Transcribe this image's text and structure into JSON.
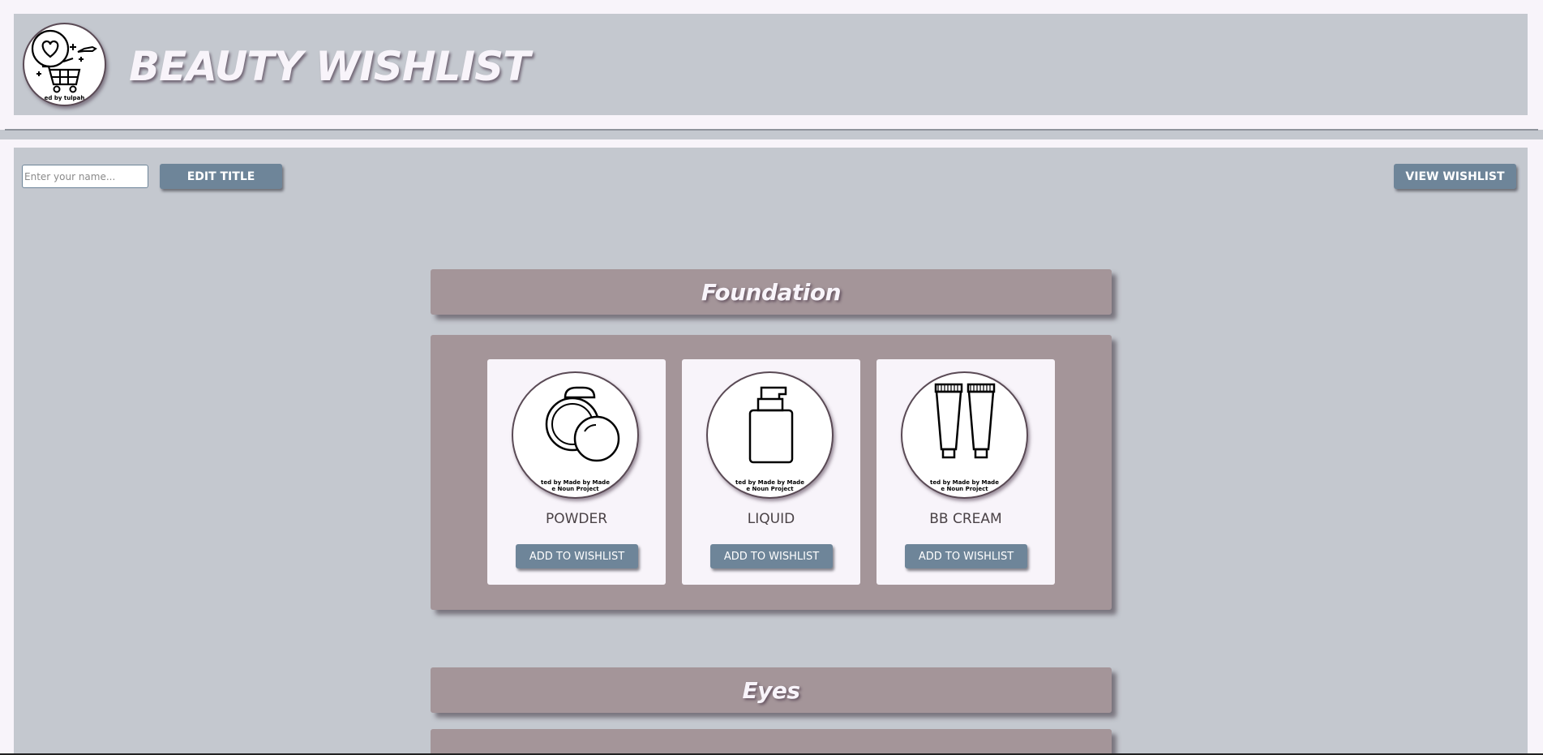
{
  "header": {
    "title": "BEAUTY WISHLIST",
    "logo_icon": "heart-cart-icon",
    "logo_credit": "ed by tulpah"
  },
  "toolbar": {
    "name_placeholder": "Enter your name...",
    "name_value": "",
    "edit_title_label": "EDIT TITLE",
    "view_wishlist_label": "VIEW WISHLIST"
  },
  "categories": [
    {
      "title": "Foundation",
      "products": [
        {
          "name": "POWDER",
          "icon": "compact-powder-icon",
          "credit_line1": "ted by Made by Made",
          "credit_line2": "e Noun Project",
          "button_label": "ADD TO WISHLIST"
        },
        {
          "name": "LIQUID",
          "icon": "pump-bottle-icon",
          "credit_line1": "ted by Made by Made",
          "credit_line2": "e Noun Project",
          "button_label": "ADD TO WISHLIST"
        },
        {
          "name": "BB CREAM",
          "icon": "cream-tubes-icon",
          "credit_line1": "ted by Made by Made",
          "credit_line2": "e Noun Project",
          "button_label": "ADD TO WISHLIST"
        }
      ]
    },
    {
      "title": "Eyes",
      "products": []
    }
  ],
  "colors": {
    "background": "#c4c8cf",
    "frame": "#f8f4fa",
    "category": "#a49599",
    "button": "#6e8599"
  }
}
